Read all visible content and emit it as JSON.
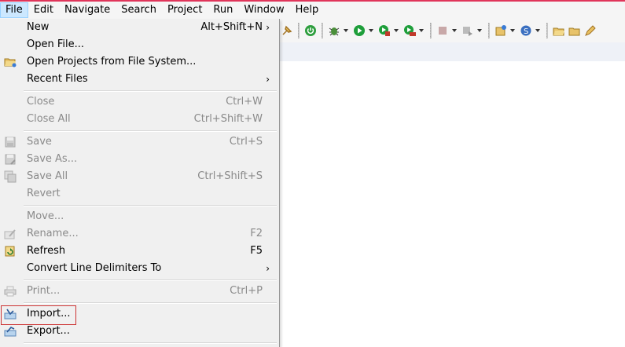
{
  "menubar": {
    "items": [
      "File",
      "Edit",
      "Navigate",
      "Search",
      "Project",
      "Run",
      "Window",
      "Help"
    ]
  },
  "file_menu": {
    "items": [
      {
        "label": "New",
        "shortcut": "Alt+Shift+N",
        "submenu": true,
        "enabled": true,
        "icon": "none"
      },
      {
        "label": "Open File...",
        "shortcut": "",
        "enabled": true,
        "icon": "none"
      },
      {
        "label": "Open Projects from File System...",
        "shortcut": "",
        "enabled": true,
        "icon": "folder-icon"
      },
      {
        "label": "Recent Files",
        "shortcut": "",
        "submenu": true,
        "enabled": true,
        "icon": "none"
      },
      {
        "label": "Close",
        "shortcut": "Ctrl+W",
        "enabled": false
      },
      {
        "label": "Close All",
        "shortcut": "Ctrl+Shift+W",
        "enabled": false
      },
      {
        "label": "Save",
        "shortcut": "Ctrl+S",
        "enabled": false,
        "icon": "save-icon"
      },
      {
        "label": "Save As...",
        "shortcut": "",
        "enabled": false,
        "icon": "save-as-icon"
      },
      {
        "label": "Save All",
        "shortcut": "Ctrl+Shift+S",
        "enabled": false,
        "icon": "save-all-icon"
      },
      {
        "label": "Revert",
        "shortcut": "",
        "enabled": false
      },
      {
        "label": "Move...",
        "shortcut": "",
        "enabled": false
      },
      {
        "label": "Rename...",
        "shortcut": "F2",
        "enabled": false,
        "icon": "rename-icon"
      },
      {
        "label": "Refresh",
        "shortcut": "F5",
        "enabled": true,
        "icon": "refresh-icon"
      },
      {
        "label": "Convert Line Delimiters To",
        "shortcut": "",
        "submenu": true,
        "enabled": true
      },
      {
        "label": "Print...",
        "shortcut": "Ctrl+P",
        "enabled": false,
        "icon": "print-icon"
      },
      {
        "label": "Import...",
        "shortcut": "",
        "enabled": true,
        "icon": "import-icon",
        "highlighted": true
      },
      {
        "label": "Export...",
        "shortcut": "",
        "enabled": true,
        "icon": "export-icon"
      }
    ],
    "submenu_arrow": "›"
  },
  "colors": {
    "menu_bg": "#f0f0f0",
    "active_menu_bg": "#cce8ff",
    "disabled_text": "#8a8a8a",
    "highlight_border": "#cc3333",
    "top_accent": "#e0355a"
  }
}
